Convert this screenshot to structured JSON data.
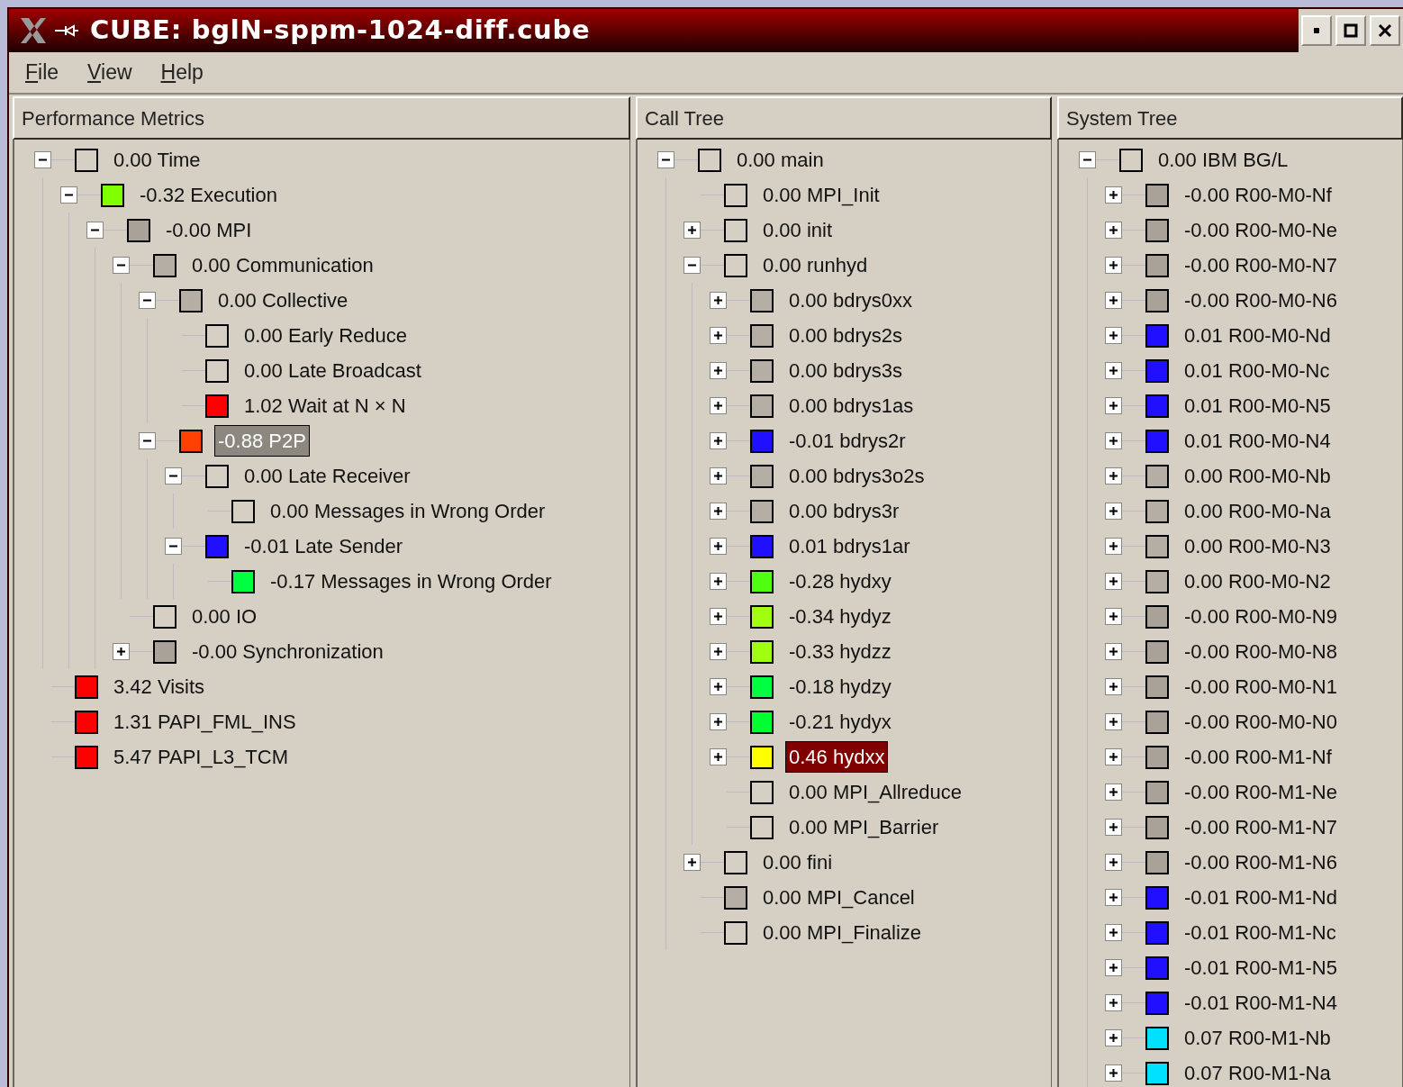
{
  "window": {
    "title": "CUBE:  bglN-sppm-1024-diff.cube"
  },
  "menu": [
    "File",
    "View",
    "Help"
  ],
  "panes": [
    {
      "title": "Performance Metrics",
      "tree": [
        {
          "label": "0.00 Time",
          "color": "#d6d0c4",
          "expanded": true,
          "selected": false,
          "children": [
            {
              "label": "-0.32 Execution",
              "color": "#80ff00",
              "expanded": true,
              "selected": false,
              "children": [
                {
                  "label": "-0.00 MPI",
                  "color": "#a8a298",
                  "expanded": true,
                  "selected": false,
                  "children": [
                    {
                      "label": "0.00 Communication",
                      "color": "#b4aea4",
                      "expanded": true,
                      "selected": false,
                      "children": [
                        {
                          "label": "0.00 Collective",
                          "color": "#b4aea4",
                          "expanded": true,
                          "selected": false,
                          "children": [
                            {
                              "label": "0.00 Early Reduce",
                              "color": "#d6d0c4",
                              "selected": false
                            },
                            {
                              "label": "0.00 Late Broadcast",
                              "color": "#d6d0c4",
                              "selected": false
                            },
                            {
                              "label": "1.02 Wait at N × N",
                              "color": "#ff0000",
                              "selected": false
                            }
                          ]
                        },
                        {
                          "label": "-0.88 P2P",
                          "color": "#ff4000",
                          "expanded": true,
                          "selected": true,
                          "highlight": {
                            "color": "#8c8880"
                          },
                          "children": [
                            {
                              "label": "0.00 Late Receiver",
                              "color": "#d6d0c4",
                              "expanded": true,
                              "selected": false,
                              "children": [
                                {
                                  "label": "0.00 Messages in Wrong Order",
                                  "color": "#d6d0c4",
                                  "selected": false
                                }
                              ]
                            },
                            {
                              "label": "-0.01 Late Sender",
                              "color": "#2010ff",
                              "expanded": true,
                              "selected": false,
                              "children": [
                                {
                                  "label": "-0.17 Messages in Wrong Order",
                                  "color": "#00ff40",
                                  "selected": false
                                }
                              ]
                            }
                          ]
                        }
                      ]
                    },
                    {
                      "label": "0.00 IO",
                      "color": "#d6d0c4",
                      "selected": false
                    },
                    {
                      "label": "-0.00 Synchronization",
                      "color": "#a8a298",
                      "expanded": false,
                      "selected": false
                    }
                  ]
                }
              ]
            }
          ]
        },
        {
          "label": "3.42 Visits",
          "color": "#ff0000",
          "selected": false
        },
        {
          "label": "1.31 PAPI_FML_INS",
          "color": "#ff0000",
          "selected": false
        },
        {
          "label": "5.47 PAPI_L3_TCM",
          "color": "#ff0000",
          "selected": false
        }
      ]
    },
    {
      "title": "Call Tree",
      "tree": [
        {
          "label": "0.00 main",
          "color": "#d6d0c4",
          "expanded": true,
          "selected": false,
          "children": [
            {
              "label": "0.00 MPI_Init",
              "color": "#d6d0c4",
              "selected": false
            },
            {
              "label": "0.00 init",
              "color": "#d6d0c4",
              "expanded": false,
              "selected": false
            },
            {
              "label": "0.00 runhyd",
              "color": "#d6d0c4",
              "expanded": true,
              "selected": false,
              "children": [
                {
                  "label": "0.00 bdrys0xx",
                  "color": "#b4aea4",
                  "expanded": false,
                  "selected": false
                },
                {
                  "label": "0.00 bdrys2s",
                  "color": "#b4aea4",
                  "expanded": false,
                  "selected": false
                },
                {
                  "label": "0.00 bdrys3s",
                  "color": "#b4aea4",
                  "expanded": false,
                  "selected": false
                },
                {
                  "label": "0.00 bdrys1as",
                  "color": "#b4aea4",
                  "expanded": false,
                  "selected": false
                },
                {
                  "label": "-0.01 bdrys2r",
                  "color": "#2010ff",
                  "expanded": false,
                  "selected": false
                },
                {
                  "label": "0.00 bdrys3o2s",
                  "color": "#b4aea4",
                  "expanded": false,
                  "selected": false
                },
                {
                  "label": "0.00 bdrys3r",
                  "color": "#b4aea4",
                  "expanded": false,
                  "selected": false
                },
                {
                  "label": "0.01 bdrys1ar",
                  "color": "#2010ff",
                  "expanded": false,
                  "selected": false
                },
                {
                  "label": "-0.28 hydxy",
                  "color": "#50ff10",
                  "expanded": false,
                  "selected": false
                },
                {
                  "label": "-0.34 hydyz",
                  "color": "#a0ff10",
                  "expanded": false,
                  "selected": false
                },
                {
                  "label": "-0.33 hydzz",
                  "color": "#a0ff10",
                  "expanded": false,
                  "selected": false
                },
                {
                  "label": "-0.18 hydzy",
                  "color": "#00ff40",
                  "expanded": false,
                  "selected": false
                },
                {
                  "label": "-0.21 hydyx",
                  "color": "#00ff30",
                  "expanded": false,
                  "selected": false
                },
                {
                  "label": "0.46 hydxx",
                  "color": "#ffff00",
                  "expanded": false,
                  "selected": true,
                  "highlight": {
                    "color": "#800000"
                  }
                },
                {
                  "label": "0.00 MPI_Allreduce",
                  "color": "#d6d0c4",
                  "selected": false
                },
                {
                  "label": "0.00 MPI_Barrier",
                  "color": "#d6d0c4",
                  "selected": false
                }
              ]
            },
            {
              "label": "0.00 fini",
              "color": "#d6d0c4",
              "expanded": false,
              "selected": false
            },
            {
              "label": "0.00 MPI_Cancel",
              "color": "#b4aea4",
              "selected": false
            },
            {
              "label": "0.00 MPI_Finalize",
              "color": "#d6d0c4",
              "selected": false
            }
          ]
        }
      ]
    },
    {
      "title": "System Tree",
      "tree": [
        {
          "label": "0.00 IBM BG/L",
          "color": "#d6d0c4",
          "expanded": true,
          "selected": false,
          "children": [
            {
              "label": "-0.00 R00-M0-Nf",
              "color": "#a8a298",
              "expanded": false,
              "selected": false
            },
            {
              "label": "-0.00 R00-M0-Ne",
              "color": "#a8a298",
              "expanded": false,
              "selected": false
            },
            {
              "label": "-0.00 R00-M0-N7",
              "color": "#a8a298",
              "expanded": false,
              "selected": false
            },
            {
              "label": "-0.00 R00-M0-N6",
              "color": "#a8a298",
              "expanded": false,
              "selected": false
            },
            {
              "label": "0.01 R00-M0-Nd",
              "color": "#2010ff",
              "expanded": false,
              "selected": false
            },
            {
              "label": "0.01 R00-M0-Nc",
              "color": "#2010ff",
              "expanded": false,
              "selected": false
            },
            {
              "label": "0.01 R00-M0-N5",
              "color": "#2010ff",
              "expanded": false,
              "selected": false
            },
            {
              "label": "0.01 R00-M0-N4",
              "color": "#2010ff",
              "expanded": false,
              "selected": false
            },
            {
              "label": "0.00 R00-M0-Nb",
              "color": "#b4aea4",
              "expanded": false,
              "selected": false
            },
            {
              "label": "0.00 R00-M0-Na",
              "color": "#b4aea4",
              "expanded": false,
              "selected": false
            },
            {
              "label": "0.00 R00-M0-N3",
              "color": "#b4aea4",
              "expanded": false,
              "selected": false
            },
            {
              "label": "0.00 R00-M0-N2",
              "color": "#b4aea4",
              "expanded": false,
              "selected": false
            },
            {
              "label": "-0.00 R00-M0-N9",
              "color": "#a8a298",
              "expanded": false,
              "selected": false
            },
            {
              "label": "-0.00 R00-M0-N8",
              "color": "#a8a298",
              "expanded": false,
              "selected": false
            },
            {
              "label": "-0.00 R00-M0-N1",
              "color": "#a8a298",
              "expanded": false,
              "selected": false
            },
            {
              "label": "-0.00 R00-M0-N0",
              "color": "#a8a298",
              "expanded": false,
              "selected": false
            },
            {
              "label": "-0.00 R00-M1-Nf",
              "color": "#a8a298",
              "expanded": false,
              "selected": false
            },
            {
              "label": "-0.00 R00-M1-Ne",
              "color": "#a8a298",
              "expanded": false,
              "selected": false
            },
            {
              "label": "-0.00 R00-M1-N7",
              "color": "#a8a298",
              "expanded": false,
              "selected": false
            },
            {
              "label": "-0.00 R00-M1-N6",
              "color": "#a8a298",
              "expanded": false,
              "selected": false
            },
            {
              "label": "-0.01 R00-M1-Nd",
              "color": "#2010ff",
              "expanded": false,
              "selected": false
            },
            {
              "label": "-0.01 R00-M1-Nc",
              "color": "#2010ff",
              "expanded": false,
              "selected": false
            },
            {
              "label": "-0.01 R00-M1-N5",
              "color": "#2010ff",
              "expanded": false,
              "selected": false
            },
            {
              "label": "-0.01 R00-M1-N4",
              "color": "#2010ff",
              "expanded": false,
              "selected": false
            },
            {
              "label": "0.07 R00-M1-Nb",
              "color": "#00e0ff",
              "expanded": false,
              "selected": false
            },
            {
              "label": "0.07 R00-M1-Na",
              "color": "#00e0ff",
              "expanded": false,
              "selected": false
            }
          ]
        }
      ]
    }
  ]
}
